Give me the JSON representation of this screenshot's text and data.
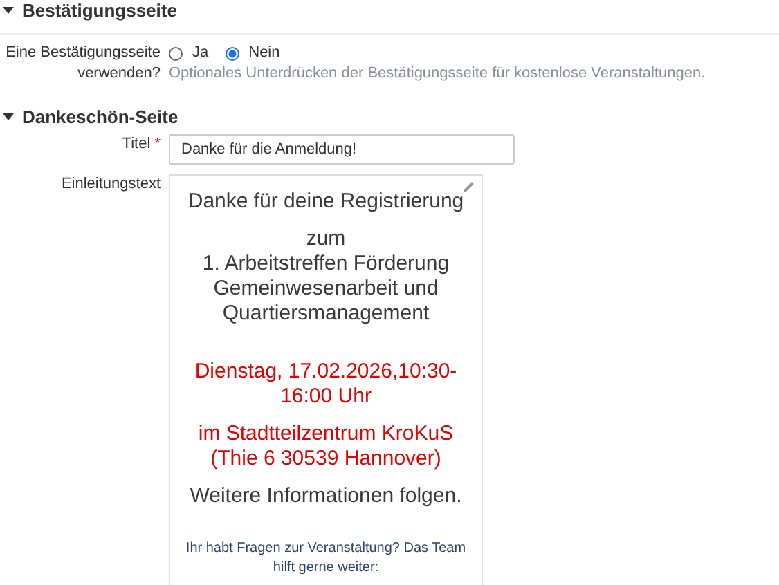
{
  "sections": [
    {
      "title": "Bestätigungsseite",
      "expanded": true,
      "fields": [
        {
          "kind": "radio",
          "label": "Eine Bestätigungsseite verwenden?",
          "options": [
            {
              "label": "Ja",
              "selected": false
            },
            {
              "label": "Nein",
              "selected": true
            }
          ],
          "help": "Optionales Unterdrücken der Bestätigungsseite für kostenlose Veranstaltungen."
        }
      ]
    },
    {
      "title": "Dankeschön-Seite",
      "expanded": true,
      "fields": [
        {
          "kind": "text",
          "label": "Titel",
          "required_mark": "*",
          "value": "Danke für die Anmeldung!"
        },
        {
          "kind": "editor",
          "label": "Einleitungstext",
          "paragraphs": [
            {
              "kind": "normal",
              "text": "Danke für deine Registrierung"
            },
            {
              "kind": "normal",
              "text": "zum\n1. Arbeitstreffen Förderung Gemeinwesenarbeit und Quartiersmanagement"
            },
            {
              "kind": "highlight",
              "text": "Dienstag, 17.02.2026,10:30-16:00 Uhr"
            },
            {
              "kind": "highlight",
              "text": "im Stadtteilzentrum KroKuS (Thie 6 30539 Hannover)"
            },
            {
              "kind": "normal",
              "text": "Weitere Informationen folgen."
            },
            {
              "kind": "small",
              "text": "Ihr habt Fragen zur Veranstaltung? Das Team hilft gerne weiter:"
            }
          ]
        }
      ]
    }
  ]
}
